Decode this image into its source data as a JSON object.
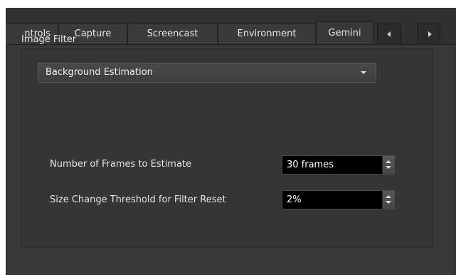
{
  "tabs": [
    {
      "label": "ntrols"
    },
    {
      "label": "Capture"
    },
    {
      "label": "Screencast"
    },
    {
      "label": "Environment"
    },
    {
      "label": "Gemini",
      "active": true
    }
  ],
  "group": {
    "title": "Image Filter",
    "filter_select": {
      "selected": "Background Estimation"
    },
    "fields": [
      {
        "label": "Number of Frames to Estimate",
        "value": "30 frames"
      },
      {
        "label": "Size Change Threshold for Filter Reset",
        "value": "2%"
      }
    ]
  },
  "icons": {
    "tab_scroll_left": "triangle-left-icon",
    "tab_scroll_right": "triangle-right-icon",
    "combo_arrow": "chevron-down-icon",
    "spin_up": "triangle-up-icon",
    "spin_down": "triangle-down-icon"
  }
}
